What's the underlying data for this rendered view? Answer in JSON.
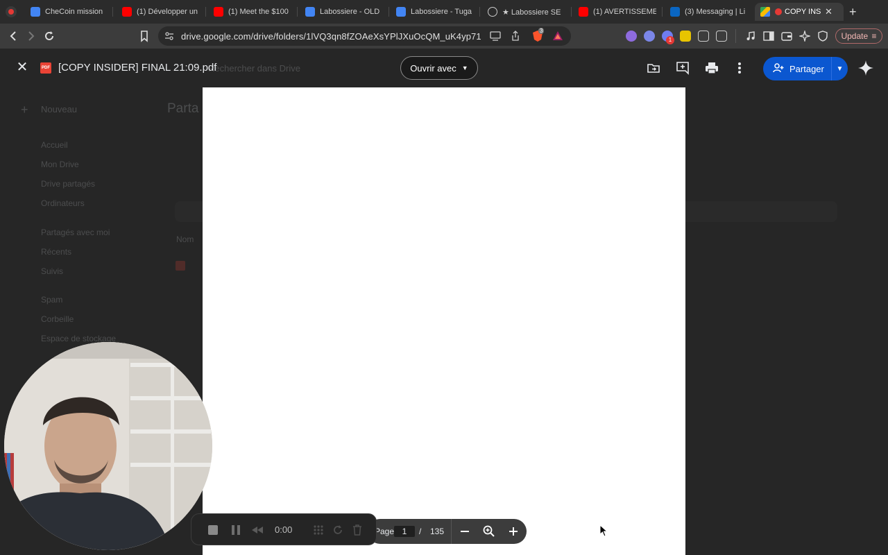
{
  "browser": {
    "tabs": [
      {
        "label": "CheCoin mission",
        "favicon": "google-docs-icon",
        "color": "#4285f4"
      },
      {
        "label": "(1) Développer un",
        "favicon": "youtube-icon",
        "color": "#ff0000"
      },
      {
        "label": "(1) Meet the $100",
        "favicon": "youtube-icon",
        "color": "#ff0000"
      },
      {
        "label": "Labossiere - OLD",
        "favicon": "google-docs-icon",
        "color": "#4285f4"
      },
      {
        "label": "Labossiere - Tuga",
        "favicon": "google-docs-icon",
        "color": "#4285f4"
      },
      {
        "label": "★ Labossiere SE",
        "favicon": "chatgpt-icon",
        "color": "#cccccc"
      },
      {
        "label": "(1) AVERTISSEME",
        "favicon": "youtube-icon",
        "color": "#ff0000"
      },
      {
        "label": "(3) Messaging | Li",
        "favicon": "linkedin-icon",
        "color": "#0a66c2"
      },
      {
        "label": "COPY INS",
        "favicon": "google-drive-icon",
        "color": "#fbbc04",
        "active": true
      }
    ],
    "url": "drive.google.com/drive/folders/1lVQ3qn8fZOAeXsYPlJXuOcQM_uK4yp71",
    "update_label": "Update",
    "extension_badge": "1",
    "brave_badge": "3"
  },
  "drive_background": {
    "new_label": "Nouveau",
    "heading": "Parta",
    "search_placeholder": "Rechercher dans Drive",
    "nav_items": [
      "Accueil",
      "Mon Drive",
      "Drive partagés",
      "Ordinateurs",
      "Partagés avec moi",
      "Récents",
      "Suivis",
      "Spam",
      "Corbeille",
      "Espace de stockage"
    ],
    "column_name": "Nom"
  },
  "viewer": {
    "file_title": "[COPY INSIDER] FINAL 21:09.pdf",
    "file_type_badge": "PDF",
    "open_with_label": "Ouvrir avec",
    "share_label": "Partager"
  },
  "page_toolbar": {
    "page_label": "Page",
    "current_page": "1",
    "separator": "/",
    "total_pages": "135"
  },
  "recorder": {
    "time": "0:00"
  }
}
